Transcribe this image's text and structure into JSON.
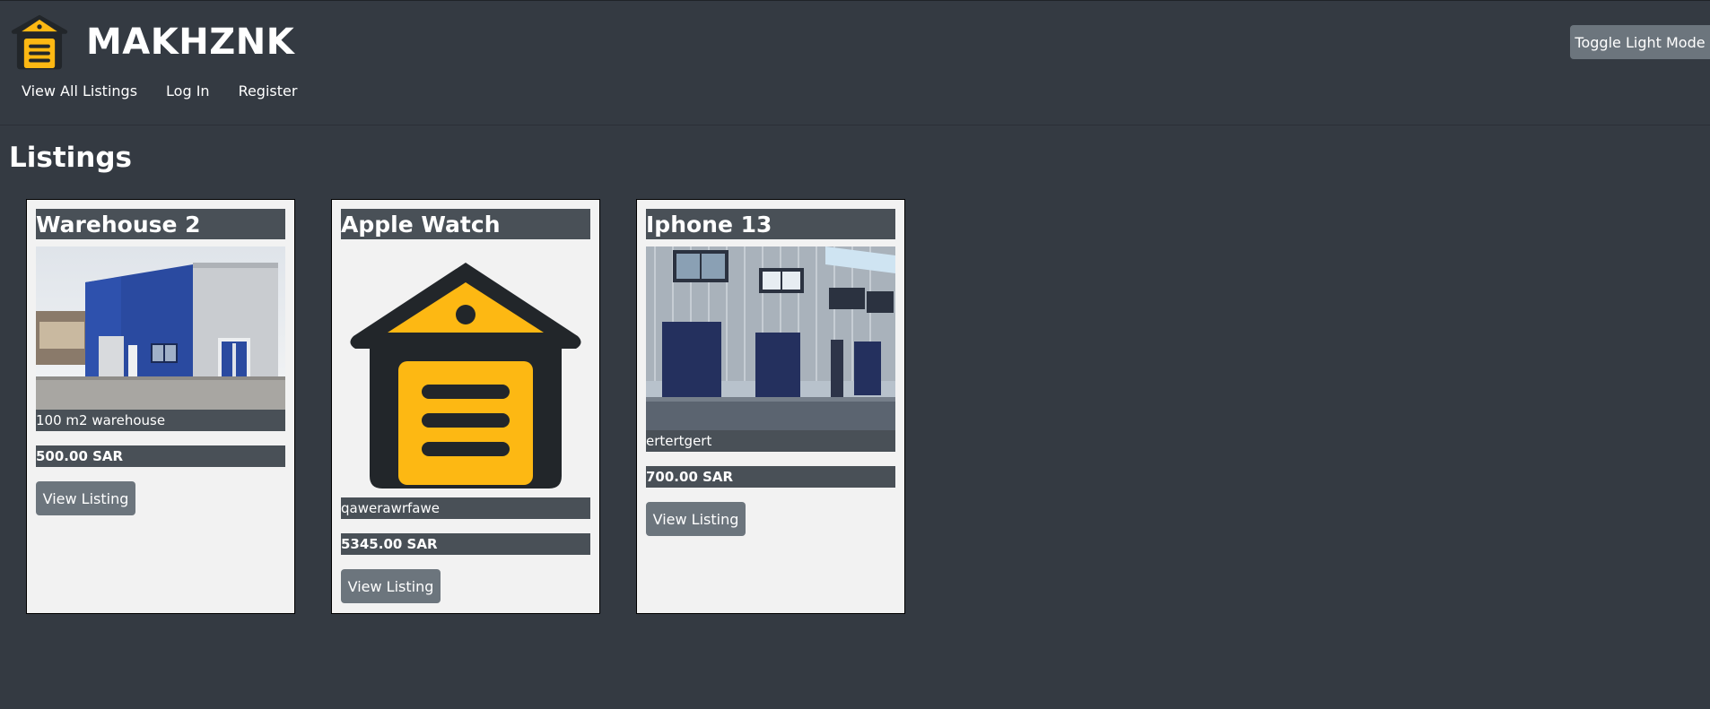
{
  "header": {
    "brand_name": "MAKHZNK",
    "toggle_label": "Toggle Light Mode",
    "nav": [
      "View All Listings",
      "Log In",
      "Register"
    ]
  },
  "page": {
    "title": "Listings"
  },
  "listings": [
    {
      "title": "Warehouse 2",
      "image": "warehouse-photo",
      "description": "100 m2 warehouse",
      "price": "500.00 SAR",
      "button": "View Listing"
    },
    {
      "title": "Apple Watch",
      "image": "garage-logo",
      "description": "qawerawrfawe",
      "price": "5345.00 SAR",
      "button": "View Listing"
    },
    {
      "title": "Iphone 13",
      "image": "storage-units-photo",
      "description": "ertertgert",
      "price": "700.00 SAR",
      "button": "View Listing"
    }
  ],
  "colors": {
    "background": "#343a42",
    "bar": "#495057",
    "button": "#6c757d",
    "logo_yellow": "#fdb813",
    "logo_dark": "#22262a"
  }
}
